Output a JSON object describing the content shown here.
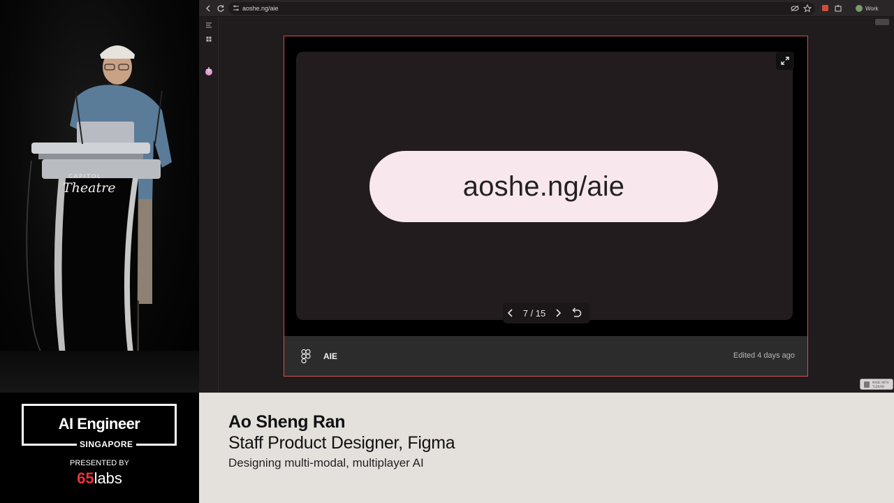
{
  "browser": {
    "url": "aoshe.ng/aie",
    "profile_label": "Work",
    "icons": [
      "back-arrow-icon",
      "reload-icon",
      "site-info-icon",
      "eye-off-icon",
      "star-icon",
      "extension-icon",
      "puzzle-icon"
    ]
  },
  "embed": {
    "slide_text": "aoshe.ng/aie",
    "page_indicator": "7 / 15",
    "file_name": "AIE",
    "edited": "Edited 4 days ago"
  },
  "stage": {
    "podium_top": "CAPITOL",
    "podium_main": "Theatre"
  },
  "made_with": {
    "line1": "MADE WITH",
    "line2": "TLDRAW"
  },
  "event": {
    "title": "AI Engineer",
    "location": "SINGAPORE",
    "presented_by": "PRESENTED BY",
    "sponsor_number": "65",
    "sponsor_word": "labs",
    "sponsor_color": "#e8353b"
  },
  "speaker": {
    "name": "Ao Sheng Ran",
    "role": "Staff Product Designer, Figma",
    "talk": "Designing multi-modal, multiplayer AI"
  },
  "colors": {
    "embed_border": "#d4525a",
    "pill_bg": "#f8e8ee",
    "canvas_bg": "#201b1c",
    "lower_third_bg": "#e4e1dd"
  }
}
